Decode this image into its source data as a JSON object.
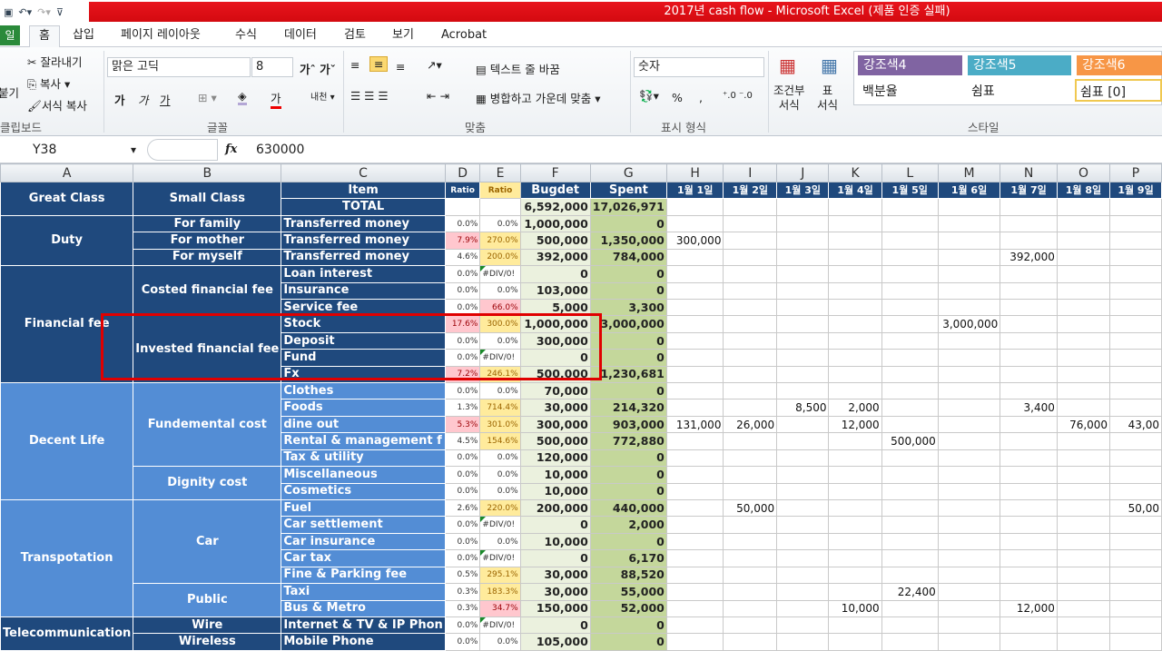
{
  "window": {
    "title": "2017년 cash flow  -  Microsoft Excel (제품 인증 실패)"
  },
  "ribbon_tabs": {
    "file": "일",
    "items": [
      "홈",
      "삽입",
      "페이지 레이아웃",
      "수식",
      "데이터",
      "검토",
      "보기",
      "Acrobat"
    ],
    "active": "홈"
  },
  "clipboard": {
    "paste": "붙기",
    "cut": "잘라내기",
    "copy": "복사",
    "format_painter": "서식 복사",
    "group": "클립보드"
  },
  "font": {
    "name": "맑은 고딕",
    "size": "8",
    "bold": "가",
    "italic": "가",
    "underline": "가",
    "font_color_label": "가",
    "group": "글꼴"
  },
  "alignment": {
    "wrap": "텍스트 줄 바꿈",
    "merge": "병합하고 가운데 맞춤",
    "group": "맞춤"
  },
  "number": {
    "format": "숫자",
    "percent": "%",
    "comma": ",",
    "group": "표시 형식"
  },
  "styles": {
    "conditional": "조건부\n서식",
    "table": "표\n서식",
    "accent4": "강조색4",
    "accent5": "강조색5",
    "accent6": "강조색6",
    "percent": "백분율",
    "comma": "쉼표",
    "comma0": "쉼표 [0]",
    "group": "스타일",
    "colors": {
      "accent4": "#8064a2",
      "accent5": "#4bacc6",
      "accent6": "#f79646"
    }
  },
  "formula_bar": {
    "name_box": "Y38",
    "fx": "fx",
    "value": "630000"
  },
  "columns": [
    "A",
    "B",
    "C",
    "D",
    "E",
    "F",
    "G",
    "H",
    "I",
    "J",
    "K",
    "L",
    "M",
    "N",
    "O",
    "P"
  ],
  "header": {
    "great_class": "Great Class",
    "small_class": "Small Class",
    "item": "Item",
    "ratio_d": "Ratio",
    "ratio_e": "Ratio",
    "budget": "Bugdet",
    "spent": "Spent",
    "dates": [
      "1월 1일",
      "1월 2일",
      "1월 3일",
      "1월 4일",
      "1월 5일",
      "1월 6일",
      "1월 7일",
      "1월 8일",
      "1월 9일"
    ]
  },
  "total": {
    "label": "TOTAL",
    "budget": "6,592,000",
    "spent": "17,026,971"
  },
  "great_classes": [
    {
      "label": "Duty",
      "rows": 3,
      "tone": "dark"
    },
    {
      "label": "Financial fee",
      "rows": 7,
      "tone": "dark"
    },
    {
      "label": "Decent Life",
      "rows": 7,
      "tone": "light"
    },
    {
      "label": "Transpotation",
      "rows": 7,
      "tone": "light"
    },
    {
      "label": "Telecommunication",
      "rows": 2,
      "tone": "dark"
    }
  ],
  "small_classes": [
    {
      "label": "For family",
      "rows": 1
    },
    {
      "label": "For mother",
      "rows": 1
    },
    {
      "label": "For myself",
      "rows": 1
    },
    {
      "label": "Costed financial fee",
      "rows": 3
    },
    {
      "label": "Invested financial fee",
      "rows": 4
    },
    {
      "label": "Fundemental cost",
      "rows": 5
    },
    {
      "label": "Dignity cost",
      "rows": 2
    },
    {
      "label": "Car",
      "rows": 5
    },
    {
      "label": "Public",
      "rows": 2
    },
    {
      "label": "Wire",
      "rows": 1
    },
    {
      "label": "Wireless",
      "rows": 1
    }
  ],
  "rows": [
    {
      "item": "Transferred money",
      "d": "0.0%",
      "e": "0.0%",
      "f": "1,000,000",
      "g": "0",
      "dates": {}
    },
    {
      "item": "Transferred money",
      "d": "7.9%",
      "ds": "pink",
      "e": "270.0%",
      "es": "yel",
      "f": "500,000",
      "g": "1,350,000",
      "dates": {
        "H": "300,000"
      }
    },
    {
      "item": "Transferred money",
      "d": "4.6%",
      "e": "200.0%",
      "es": "yel",
      "f": "392,000",
      "g": "784,000",
      "dates": {
        "N": "392,000"
      }
    },
    {
      "item": "Loan interest",
      "d": "0.0%",
      "e": "#DIV/0!",
      "es": "err",
      "f": "0",
      "g": "0",
      "dates": {}
    },
    {
      "item": "Insurance",
      "d": "0.0%",
      "e": "0.0%",
      "f": "103,000",
      "g": "0",
      "dates": {}
    },
    {
      "item": "Service fee",
      "d": "0.0%",
      "e": "66.0%",
      "es": "pink",
      "f": "5,000",
      "g": "3,300",
      "dates": {}
    },
    {
      "item": "Stock",
      "d": "17.6%",
      "ds": "pink",
      "e": "300.0%",
      "es": "yel",
      "f": "1,000,000",
      "g": "3,000,000",
      "dates": {
        "M": "3,000,000"
      }
    },
    {
      "item": "Deposit",
      "d": "0.0%",
      "e": "0.0%",
      "f": "300,000",
      "g": "0",
      "dates": {}
    },
    {
      "item": "Fund",
      "d": "0.0%",
      "e": "#DIV/0!",
      "es": "err",
      "f": "0",
      "g": "0",
      "dates": {}
    },
    {
      "item": "Fx",
      "d": "7.2%",
      "ds": "pink",
      "e": "246.1%",
      "es": "yel",
      "f": "500,000",
      "g": "1,230,681",
      "dates": {}
    },
    {
      "item": "Clothes",
      "d": "0.0%",
      "e": "0.0%",
      "f": "70,000",
      "g": "0",
      "dates": {}
    },
    {
      "item": "Foods",
      "d": "1.3%",
      "e": "714.4%",
      "es": "yel",
      "f": "30,000",
      "g": "214,320",
      "dates": {
        "J": "8,500",
        "K": "2,000",
        "N": "3,400"
      }
    },
    {
      "item": "dine out",
      "d": "5.3%",
      "ds": "pink",
      "e": "301.0%",
      "es": "yel",
      "f": "300,000",
      "g": "903,000",
      "dates": {
        "H": "131,000",
        "I": "26,000",
        "K": "12,000",
        "O": "76,000",
        "P": "43,00"
      }
    },
    {
      "item": "Rental & management f",
      "d": "4.5%",
      "e": "154.6%",
      "es": "yel",
      "f": "500,000",
      "g": "772,880",
      "dates": {
        "L": "500,000"
      }
    },
    {
      "item": "Tax & utility",
      "d": "0.0%",
      "e": "0.0%",
      "f": "120,000",
      "g": "0",
      "dates": {}
    },
    {
      "item": "Miscellaneous",
      "d": "0.0%",
      "e": "0.0%",
      "f": "10,000",
      "g": "0",
      "dates": {}
    },
    {
      "item": "Cosmetics",
      "d": "0.0%",
      "e": "0.0%",
      "f": "10,000",
      "g": "0",
      "dates": {}
    },
    {
      "item": "Fuel",
      "d": "2.6%",
      "e": "220.0%",
      "es": "yel",
      "f": "200,000",
      "g": "440,000",
      "dates": {
        "I": "50,000",
        "P": "50,00"
      }
    },
    {
      "item": "Car settlement",
      "d": "0.0%",
      "e": "#DIV/0!",
      "es": "err",
      "f": "0",
      "g": "2,000",
      "dates": {}
    },
    {
      "item": "Car insurance",
      "d": "0.0%",
      "e": "0.0%",
      "f": "10,000",
      "g": "0",
      "dates": {}
    },
    {
      "item": "Car tax",
      "d": "0.0%",
      "e": "#DIV/0!",
      "es": "err",
      "f": "0",
      "g": "6,170",
      "dates": {}
    },
    {
      "item": "Fine & Parking fee",
      "d": "0.5%",
      "e": "295.1%",
      "es": "yel",
      "f": "30,000",
      "g": "88,520",
      "dates": {}
    },
    {
      "item": "Taxi",
      "d": "0.3%",
      "e": "183.3%",
      "es": "yel",
      "f": "30,000",
      "g": "55,000",
      "dates": {
        "L": "22,400"
      }
    },
    {
      "item": "Bus & Metro",
      "d": "0.3%",
      "e": "34.7%",
      "es": "pink",
      "f": "150,000",
      "g": "52,000",
      "dates": {
        "K": "10,000",
        "N": "12,000"
      }
    },
    {
      "item": "Internet & TV & IP Phon",
      "d": "0.0%",
      "e": "#DIV/0!",
      "es": "err",
      "f": "0",
      "g": "0",
      "dates": {}
    },
    {
      "item": "Mobile Phone",
      "d": "0.0%",
      "e": "0.0%",
      "f": "105,000",
      "g": "0",
      "dates": {}
    }
  ]
}
